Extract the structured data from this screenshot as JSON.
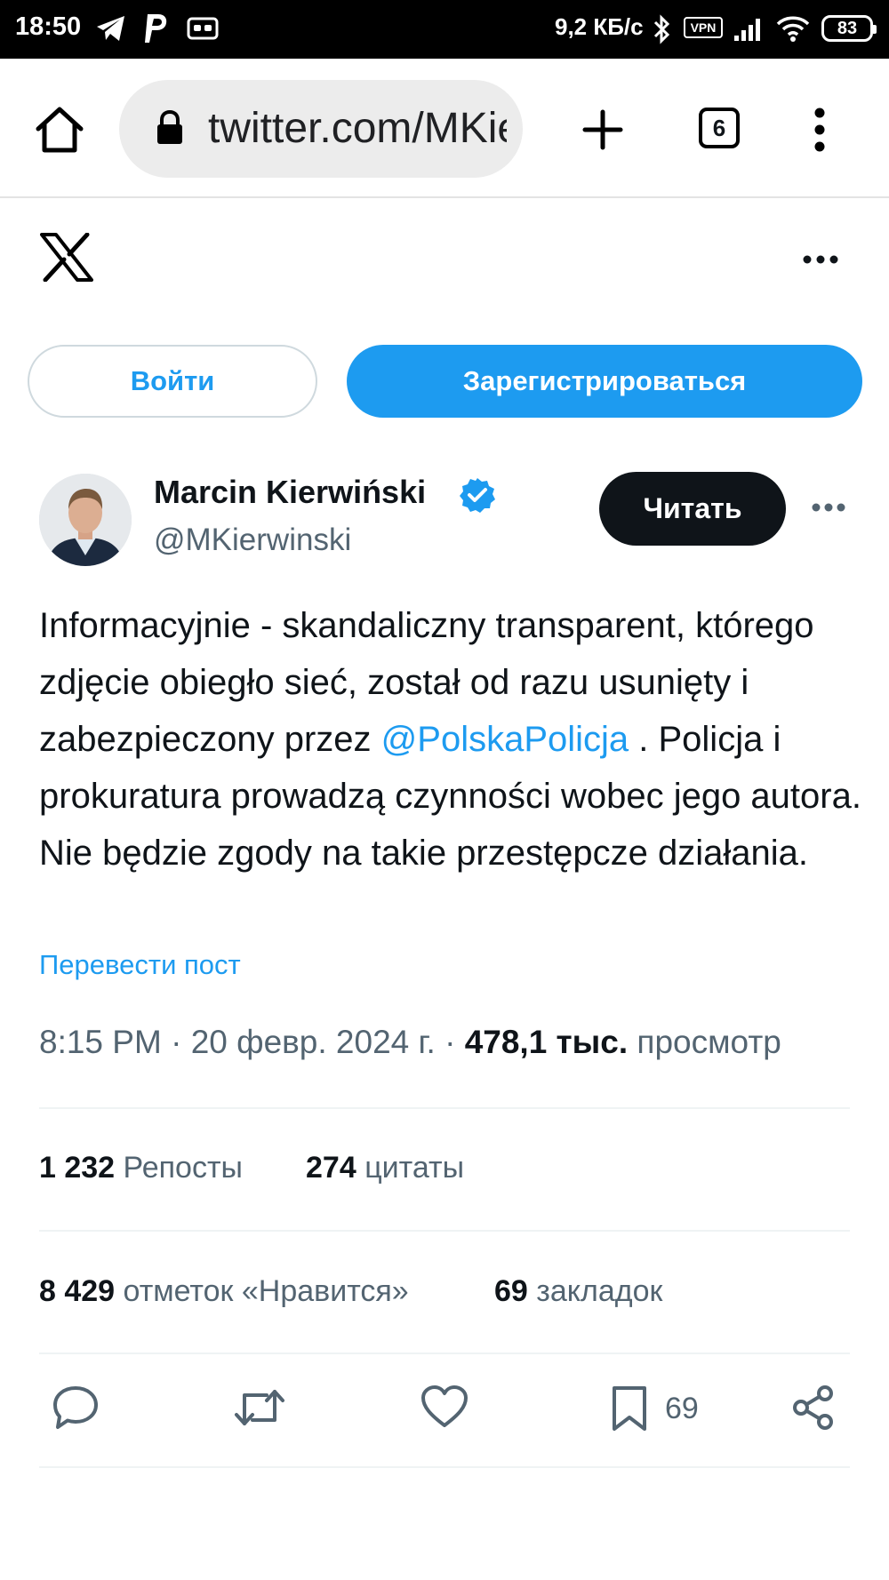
{
  "status_bar": {
    "time": "18:50",
    "network_speed": "9,2 КБ/с",
    "vpn_label": "VPN",
    "battery": "83"
  },
  "browser": {
    "url": "twitter.com/MKierwinski",
    "tab_count": "6"
  },
  "auth": {
    "login_label": "Войти",
    "signup_label": "Зарегистрироваться"
  },
  "tweet": {
    "author_name": "Marcin Kierwiński",
    "author_handle": "@MKierwinski",
    "follow_label": "Читать",
    "text_part1": "Informacyjnie - skandaliczny transparent, którego zdjęcie obiegło sieć, został od razu usunięty i zabezpieczony przez ",
    "mention": "@PolskaPolicja",
    "text_part2": " . Policja i prokuratura prowadzą czynności wobec jego autora. Nie będzie zgody na takie przestępcze działania.",
    "translate_label": "Перевести пост",
    "time": "8:15 PM",
    "separator": " · ",
    "date": "20 февр. 2024 г.",
    "views_count": "478,1 тыс.",
    "views_label": "просмотр",
    "reposts_count": "1 232",
    "reposts_label": "Репосты",
    "quotes_count": "274",
    "quotes_label": "цитаты",
    "likes_count": "8 429",
    "likes_label": "отметок «Нравится»",
    "bookmarks_count": "69",
    "bookmarks_label": "закладок",
    "bookmark_action_count": "69"
  },
  "colors": {
    "accent": "#1d9bf0",
    "text": "#0f1419",
    "secondary": "#536471"
  }
}
